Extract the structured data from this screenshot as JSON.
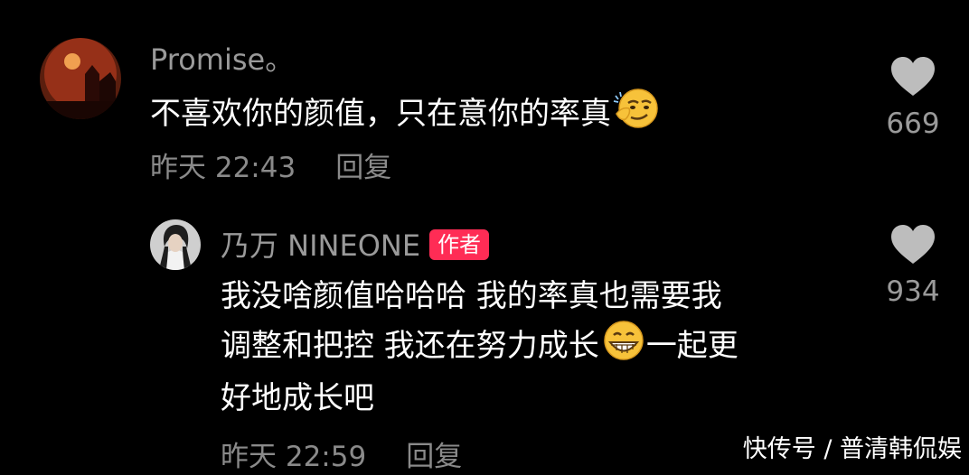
{
  "comments": [
    {
      "username": "Promise。",
      "text_line1": "不喜欢你的颜值，只在意你的率真",
      "time": "昨天 22:43",
      "reply_label": "回复",
      "likes": "669",
      "emoji": "smirk-face"
    }
  ],
  "reply": {
    "username": "乃万 NINEONE",
    "badge": "作者",
    "text_line1": "我没啥颜值哈哈哈 我的率真也需要我",
    "text_line2a": "调整和把控 我还在努力成长",
    "text_line2b": "一起更",
    "text_line3": "好地成长吧",
    "time": "昨天 22:59",
    "reply_label": "回复",
    "likes": "934",
    "emoji": "grinning-face"
  },
  "watermark": "快传号 / 普清韩侃娱",
  "colors": {
    "background": "#000000",
    "badge": "#ff2c55",
    "muted_text": "#8a8a8a"
  }
}
